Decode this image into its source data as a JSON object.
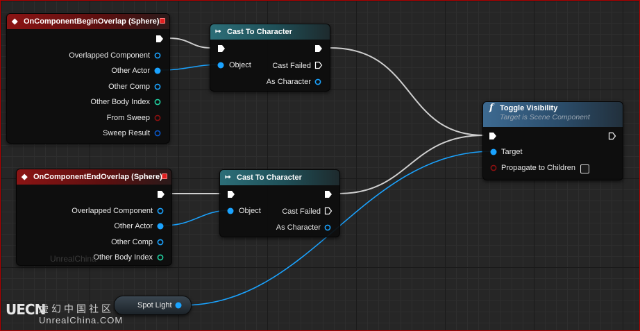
{
  "colors": {
    "exec_wire": "#cfcfcf",
    "object_pin": "#1aa3ff",
    "int_pin": "#20d0a0",
    "bool_pin": "#8b1010",
    "struct_pin": "#0a56c8",
    "event_header": "#8b1414",
    "cast_header": "#2c6e78",
    "function_header": "#3d6a91"
  },
  "nodes": {
    "begin_overlap": {
      "title": "OnComponentBeginOverlap (Sphere)",
      "pins": [
        "Overlapped Component",
        "Other Actor",
        "Other Comp",
        "Other Body Index",
        "From Sweep",
        "Sweep Result"
      ]
    },
    "end_overlap": {
      "title": "OnComponentEndOverlap (Sphere)",
      "pins": [
        "Overlapped Component",
        "Other Actor",
        "Other Comp",
        "Other Body Index"
      ]
    },
    "cast_top": {
      "title": "Cast To Character",
      "object_label": "Object",
      "failed_label": "Cast Failed",
      "as_label": "As Character"
    },
    "cast_bottom": {
      "title": "Cast To Character",
      "object_label": "Object",
      "failed_label": "Cast Failed",
      "as_label": "As Character"
    },
    "toggle": {
      "title": "Toggle Visibility",
      "subtitle": "Target is Scene Component",
      "target_label": "Target",
      "propagate_label": "Propagate to Children"
    },
    "spot_light": {
      "label": "Spot Light"
    }
  },
  "watermark": {
    "logo": "UECN",
    "cn": "虚幻中国社区",
    "en": "UnrealChina.COM",
    "ghost": "UnrealChina"
  }
}
